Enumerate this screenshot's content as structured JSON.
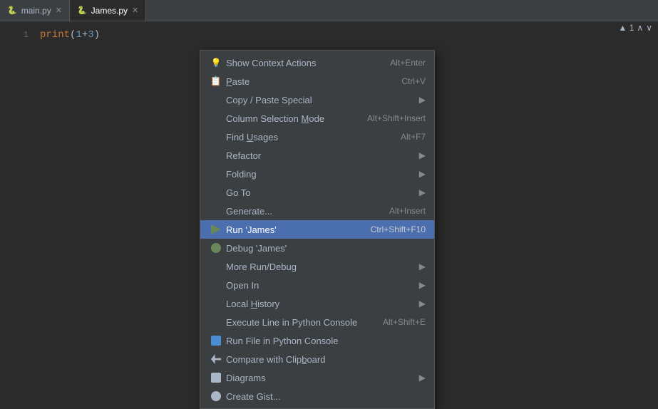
{
  "tabs": [
    {
      "label": "main.py",
      "active": false,
      "icon": "🐍"
    },
    {
      "label": "James.py",
      "active": true,
      "icon": "🐍"
    }
  ],
  "editor": {
    "line": "print(1+3)"
  },
  "top_right": {
    "warning": "▲ 1",
    "arrows": "∧ ∨"
  },
  "context_menu": {
    "items": [
      {
        "id": "show-context-actions",
        "icon": "bulb",
        "label": "Show Context Actions",
        "shortcut": "Alt+Enter",
        "has_arrow": false,
        "highlighted": false,
        "separator_after": false
      },
      {
        "id": "paste",
        "icon": "paste",
        "label": "Paste",
        "shortcut": "Ctrl+V",
        "has_arrow": false,
        "highlighted": false,
        "separator_after": false
      },
      {
        "id": "copy-paste-special",
        "icon": "",
        "label": "Copy / Paste Special",
        "shortcut": "",
        "has_arrow": true,
        "highlighted": false,
        "separator_after": false
      },
      {
        "id": "column-selection-mode",
        "icon": "",
        "label": "Column Selection Mode",
        "shortcut": "Alt+Shift+Insert",
        "has_arrow": false,
        "highlighted": false,
        "separator_after": false
      },
      {
        "id": "find-usages",
        "icon": "",
        "label": "Find Usages",
        "shortcut": "Alt+F7",
        "has_arrow": false,
        "highlighted": false,
        "separator_after": false
      },
      {
        "id": "refactor",
        "icon": "",
        "label": "Refactor",
        "shortcut": "",
        "has_arrow": true,
        "highlighted": false,
        "separator_after": false
      },
      {
        "id": "folding",
        "icon": "",
        "label": "Folding",
        "shortcut": "",
        "has_arrow": true,
        "highlighted": false,
        "separator_after": false
      },
      {
        "id": "go-to",
        "icon": "",
        "label": "Go To",
        "shortcut": "",
        "has_arrow": true,
        "highlighted": false,
        "separator_after": false
      },
      {
        "id": "generate",
        "icon": "",
        "label": "Generate...",
        "shortcut": "Alt+Insert",
        "has_arrow": false,
        "highlighted": false,
        "separator_after": false
      },
      {
        "id": "run-james",
        "icon": "run",
        "label": "Run 'James'",
        "shortcut": "Ctrl+Shift+F10",
        "has_arrow": false,
        "highlighted": true,
        "separator_after": false
      },
      {
        "id": "debug-james",
        "icon": "debug",
        "label": "Debug 'James'",
        "shortcut": "",
        "has_arrow": false,
        "highlighted": false,
        "separator_after": false
      },
      {
        "id": "more-run-debug",
        "icon": "",
        "label": "More Run/Debug",
        "shortcut": "",
        "has_arrow": true,
        "highlighted": false,
        "separator_after": false
      },
      {
        "id": "open-in",
        "icon": "",
        "label": "Open In",
        "shortcut": "",
        "has_arrow": true,
        "highlighted": false,
        "separator_after": false
      },
      {
        "id": "local-history",
        "icon": "",
        "label": "Local History",
        "shortcut": "",
        "has_arrow": true,
        "highlighted": false,
        "separator_after": false
      },
      {
        "id": "execute-line",
        "icon": "",
        "label": "Execute Line in Python Console",
        "shortcut": "Alt+Shift+E",
        "has_arrow": false,
        "highlighted": false,
        "separator_after": false
      },
      {
        "id": "run-file-python",
        "icon": "python",
        "label": "Run File in Python Console",
        "shortcut": "",
        "has_arrow": false,
        "highlighted": false,
        "separator_after": false
      },
      {
        "id": "compare-clipboard",
        "icon": "compare",
        "label": "Compare with Clipboard",
        "shortcut": "",
        "has_arrow": false,
        "highlighted": false,
        "separator_after": false
      },
      {
        "id": "diagrams",
        "icon": "diagrams",
        "label": "Diagrams",
        "shortcut": "",
        "has_arrow": true,
        "highlighted": false,
        "separator_after": false
      },
      {
        "id": "create-gist",
        "icon": "github",
        "label": "Create Gist...",
        "shortcut": "",
        "has_arrow": false,
        "highlighted": false,
        "separator_after": false
      }
    ]
  }
}
